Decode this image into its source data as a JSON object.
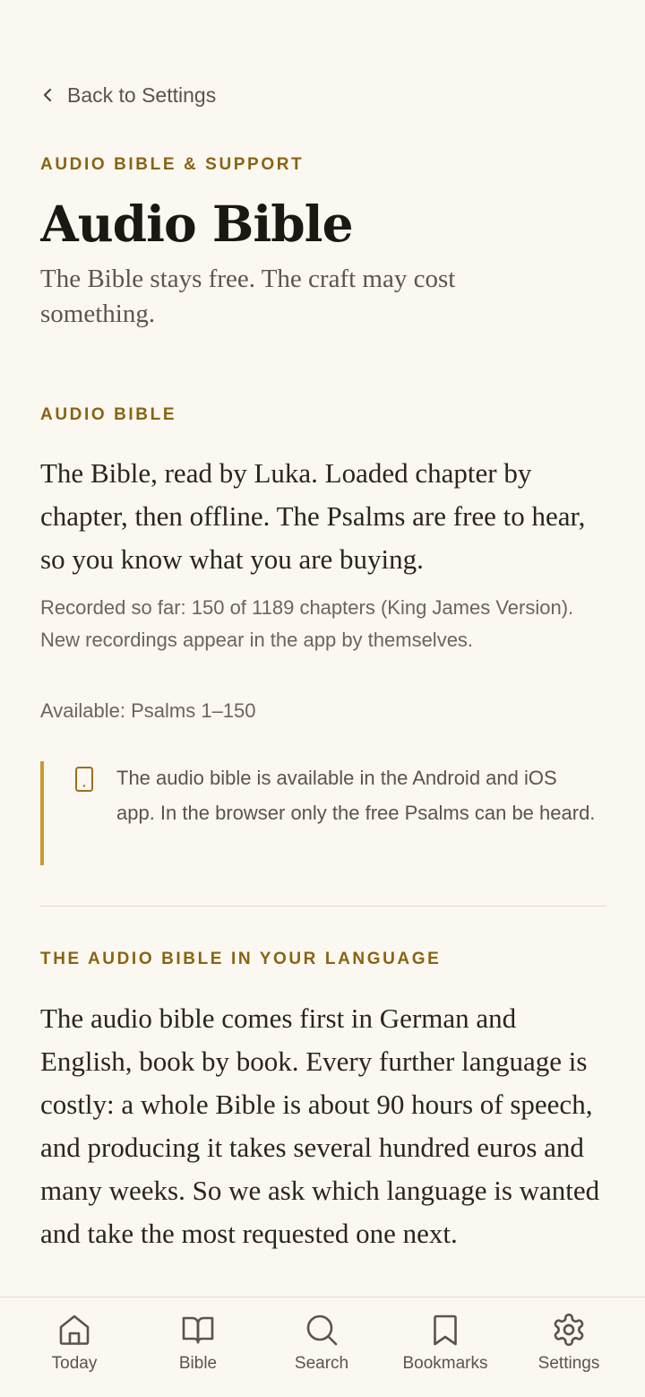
{
  "nav": {
    "back_label": "Back to Settings"
  },
  "header": {
    "eyebrow": "AUDIO BIBLE & SUPPORT",
    "title": "Audio Bible",
    "subtitle": "The Bible stays free. The craft may cost something."
  },
  "audio_section": {
    "eyebrow": "AUDIO BIBLE",
    "lead": "The Bible, read by Luka. Loaded chapter by chapter, then offline. The Psalms are free to hear, so you know what you are buying.",
    "recorded_note": "Recorded so far: 150 of 1189 chapters (King James Version). New recordings appear in the app by themselves.",
    "available": "Available: Psalms 1–150",
    "notice": {
      "icon": "phone-icon",
      "text": "The audio bible is available in the Android and iOS app. In the browser only the free Psalms can be heard."
    }
  },
  "language_section": {
    "eyebrow": "THE AUDIO BIBLE IN YOUR LANGUAGE",
    "lead": "The audio bible comes first in German and English, book by book. Every further language is costly: a whole Bible is about 90 hours of speech, and producing it takes several hundred euros and many weeks. So we ask which language is wanted and take the most requested one next."
  },
  "tabbar": {
    "items": [
      {
        "label": "Today",
        "icon": "home-icon"
      },
      {
        "label": "Bible",
        "icon": "book-icon"
      },
      {
        "label": "Search",
        "icon": "search-icon"
      },
      {
        "label": "Bookmarks",
        "icon": "bookmark-icon"
      },
      {
        "label": "Settings",
        "icon": "gear-icon"
      }
    ]
  },
  "colors": {
    "background": "#fbf8f1",
    "accent": "#8a6312",
    "notice_border": "#c99a2e",
    "text_primary": "#1f1b16",
    "text_muted": "#6b655c"
  }
}
